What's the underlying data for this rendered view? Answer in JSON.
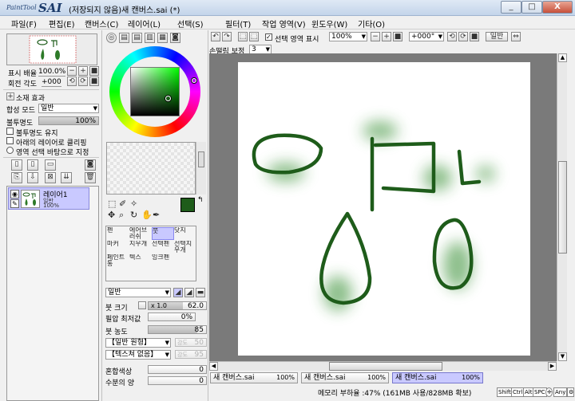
{
  "window": {
    "logo_small": "PaintTool",
    "logo_big": "SAI",
    "title": "(저장되지 않음)새 캔버스.sai (*)",
    "min": "_",
    "max": "□",
    "close": "X"
  },
  "menu": [
    "파일(F)",
    "편집(E)",
    "캔버스(C)",
    "레이어(L)",
    "선택(S)",
    "필터(T)",
    "작업 영역(V)",
    "윈도우(W)",
    "기타(O)"
  ],
  "navigator": {
    "zoom_label": "표시 배율",
    "zoom_value": "100.0%",
    "rotate_label": "회전 각도",
    "rotate_value": "+000"
  },
  "layer_panel": {
    "material_effect": "소재 효과",
    "blend_label": "합성 모드",
    "blend_value": "일반",
    "opacity_label": "불투명도",
    "opacity_value": "100%",
    "opacity_fraction": 1.0,
    "options": [
      "불투명도 유지",
      "아래의 레이어로 클리핑",
      "영역 선택 바탕으로 지정"
    ],
    "layers": [
      {
        "name": "레이어1",
        "mode": "일반",
        "opacity": "100%"
      }
    ]
  },
  "color": {
    "primary": "#1e5c1a",
    "secondary": "#ffffff"
  },
  "tools": {
    "cells": [
      "펜",
      "에어브러쉬",
      "붓",
      "닷지",
      "마커",
      "지우개",
      "선택펜",
      "선택지우개",
      "페인트통",
      "텍스",
      "잉크펜",
      ""
    ],
    "selected_index": 2,
    "mode_value": "일반",
    "size_label": "붓 크기",
    "size_mult": "x 1.0",
    "size_value": "62.0",
    "min_size_label": "필압 최저값",
    "min_size_value": "0%",
    "density_label": "붓 농도",
    "density_value": "85",
    "density_fraction": 0.85,
    "shape_value": "【일반 원형】",
    "shape_strength_label": "강도",
    "shape_strength_value": "50",
    "texture_value": "【텍스쳐 없음】",
    "texture_strength_label": "강도",
    "texture_strength_value": "95",
    "mix_label": "혼합색상",
    "mix_value": "0",
    "water_label": "수분의 양",
    "water_value": "0"
  },
  "toolbar": {
    "selection_checkbox_label": "선택 영역 표시",
    "zoom_value": "100%",
    "rotate_value": "+000°",
    "mode_button": "일반",
    "stabilizer_label": "손떨림 보정",
    "stabilizer_value": "3"
  },
  "documents": [
    {
      "name": "새 캔버스.sai",
      "zoom": "100%"
    },
    {
      "name": "새 캔버스.sai",
      "zoom": "100%"
    },
    {
      "name": "새 캔버스.sai",
      "zoom": "100%"
    }
  ],
  "status": {
    "memory": "메모리 부하율 :47% (161MB 사용/828MB 확보)",
    "keys": [
      "Shift",
      "Ctrl",
      "Alt",
      "SPC",
      "Any"
    ]
  }
}
